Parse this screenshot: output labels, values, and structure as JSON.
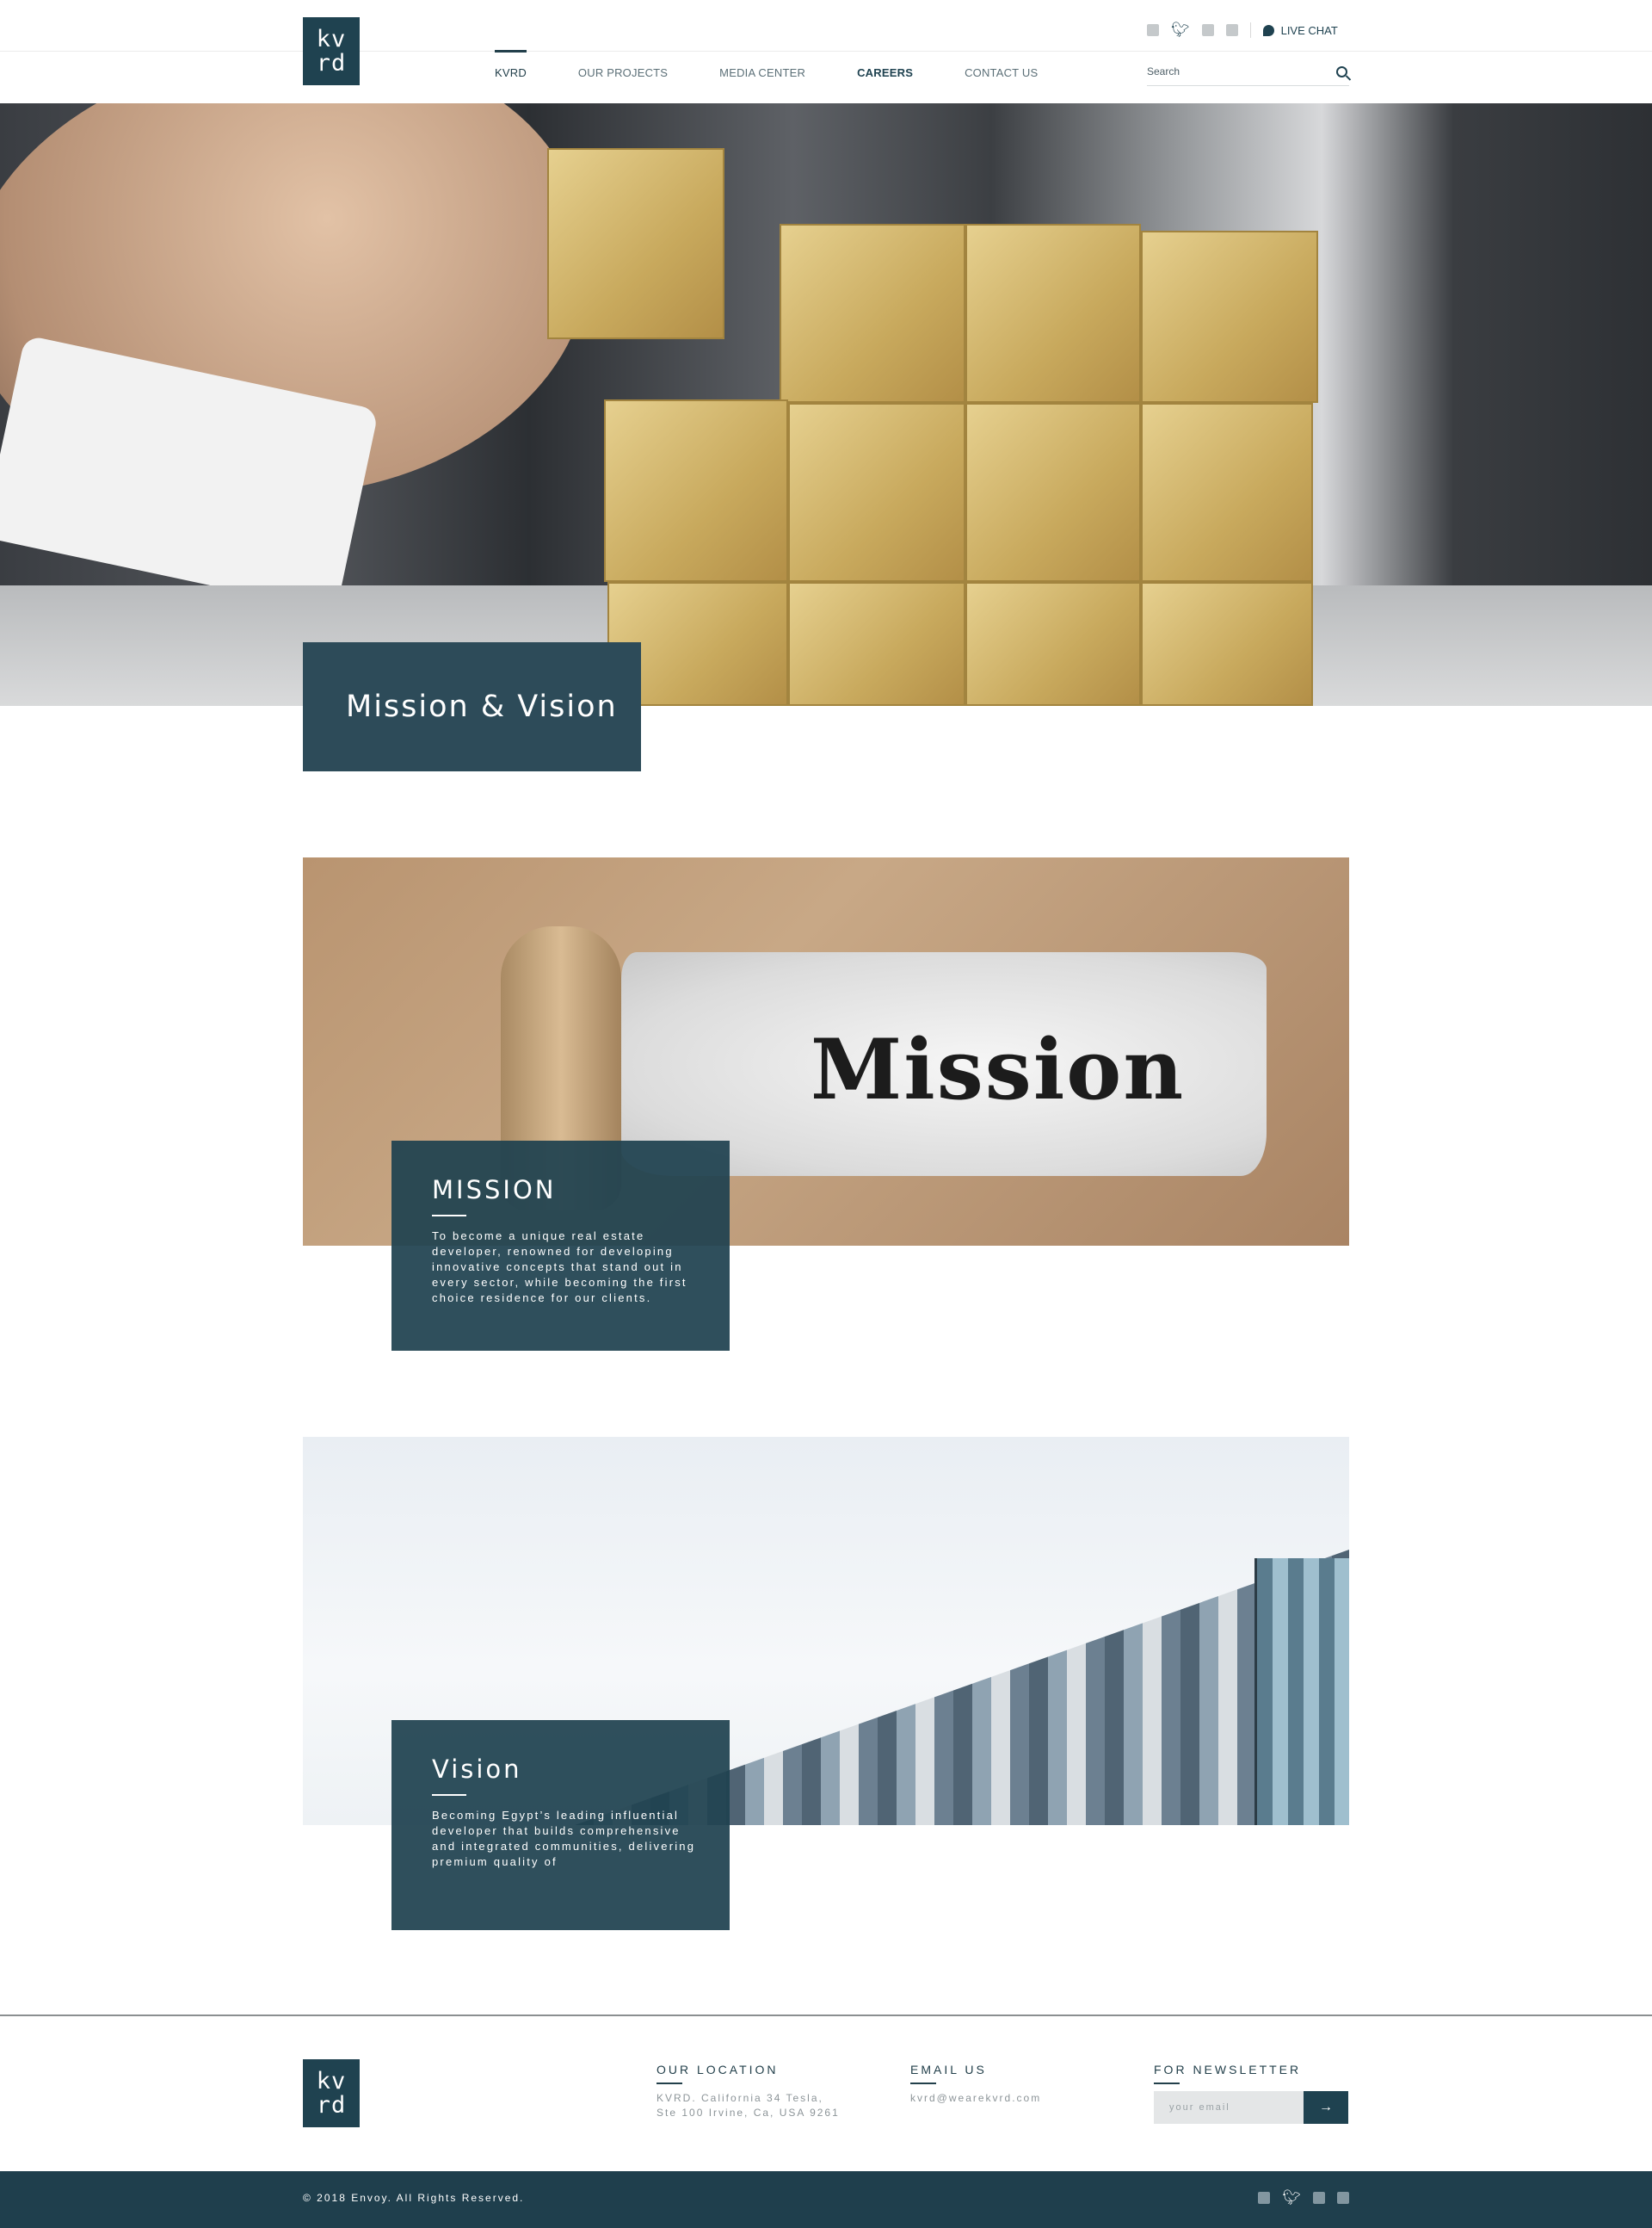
{
  "brand": {
    "logo_line1": "kv",
    "logo_line2": "rd"
  },
  "header": {
    "social_icons": [
      "facebook-icon",
      "twitter-icon",
      "instagram-icon",
      "linkedin-icon"
    ],
    "live_chat_label": "LIVE CHAT",
    "nav": [
      {
        "label": "KVRD",
        "active": true
      },
      {
        "label": "OUR PROJECTS",
        "active": false
      },
      {
        "label": "MEDIA CENTER",
        "active": false
      },
      {
        "label": "CAREERS",
        "active": false
      },
      {
        "label": "CONTACT US",
        "active": false
      }
    ],
    "search_placeholder": "Search"
  },
  "hero": {
    "title": "Mission & Vision"
  },
  "mission": {
    "image_word": "Mission",
    "heading": "MISSION",
    "text": "To become a unique real estate developer, renowned for developing innovative concepts that stand out in every sector, while becoming the first choice residence for our clients."
  },
  "vision": {
    "heading": "Vision",
    "text": "Becoming Egypt’s leading influential developer that builds comprehensive and integrated communities, delivering premium quality of"
  },
  "footer": {
    "location_title": "OUR LOCATION",
    "location_text": "KVRD. California 34 Tesla,\nSte 100 Irvine, Ca, USA 9261",
    "email_title": "EMAIL US",
    "email_text": "kvrd@wearekvrd.com",
    "newsletter_title": "FOR NEWSLETTER",
    "newsletter_placeholder": "your email",
    "newsletter_button": "→",
    "copyright": "© 2018 Envoy. All Rights Reserved."
  },
  "colors": {
    "primary": "#1f4250",
    "card": "#2d4b59",
    "text": "#23404b"
  }
}
